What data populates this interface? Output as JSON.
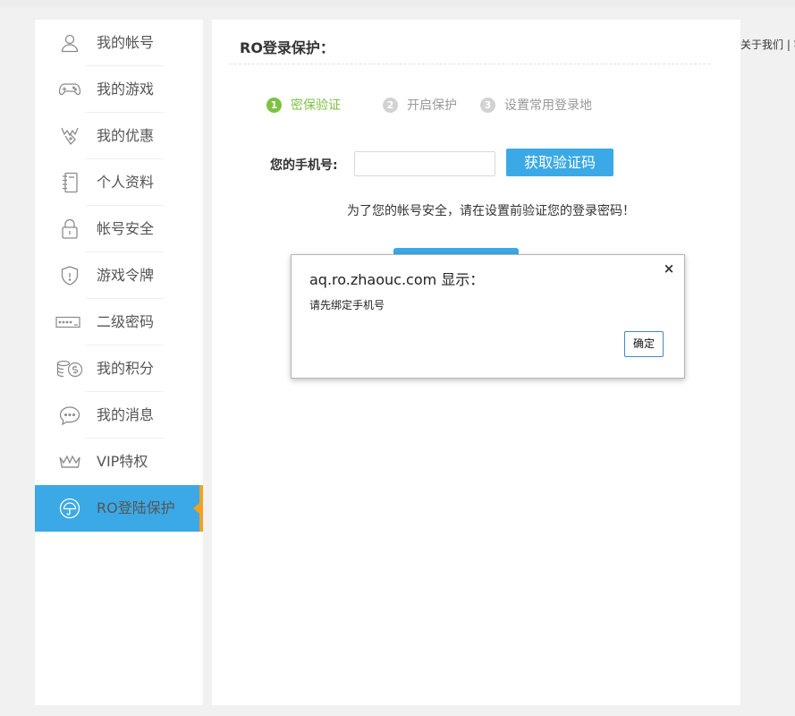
{
  "sidebar": {
    "items": [
      {
        "label": "我的帐号",
        "icon": "user-icon"
      },
      {
        "label": "我的游戏",
        "icon": "gamepad-icon"
      },
      {
        "label": "我的优惠",
        "icon": "gift-tag-icon"
      },
      {
        "label": "个人资料",
        "icon": "notebook-icon"
      },
      {
        "label": "帐号安全",
        "icon": "padlock-icon"
      },
      {
        "label": "游戏令牌",
        "icon": "shield-icon"
      },
      {
        "label": "二级密码",
        "icon": "password-box-icon"
      },
      {
        "label": "我的积分",
        "icon": "coins-icon"
      },
      {
        "label": "我的消息",
        "icon": "chat-bubble-icon"
      },
      {
        "label": "VIP特权",
        "icon": "crown-icon"
      },
      {
        "label": "RO登陆保护",
        "icon": "umbrella-icon",
        "active": true
      }
    ],
    "active_color": "#3ba9e6",
    "accent_color": "#f4a21e"
  },
  "main": {
    "title": "RO登录保护：",
    "steps": [
      {
        "num": "1",
        "label": "密保验证",
        "active": true
      },
      {
        "num": "2",
        "label": "开启保护",
        "active": false
      },
      {
        "num": "3",
        "label": "设置常用登录地",
        "active": false
      }
    ],
    "phone_label": "您的手机号:",
    "phone_value": "",
    "get_code_label": "获取验证码",
    "notice": "为了您的帐号安全，请在设置前验证您的登录密码！"
  },
  "top_links": "关于我们 | 客",
  "dialog": {
    "title": "aq.ro.zhaouc.com 显示：",
    "message": "请先绑定手机号",
    "close": "×",
    "ok_label": "确定"
  },
  "colors": {
    "step_active": "#7dc242",
    "step_inactive": "#d2d2d2",
    "button_blue": "#3ba9e6"
  }
}
